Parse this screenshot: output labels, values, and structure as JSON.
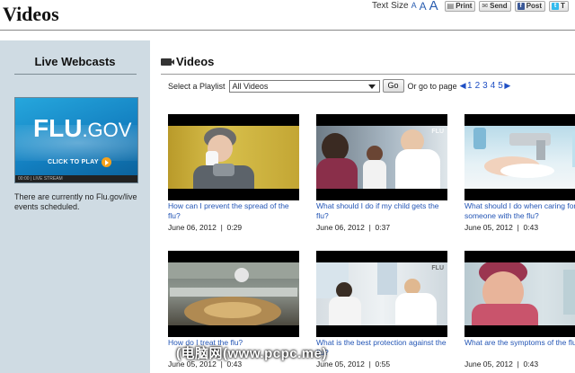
{
  "header": {
    "title": "Videos",
    "text_size_label": "Text Size",
    "text_size_glyphs": [
      "A",
      "A",
      "A"
    ],
    "buttons": [
      {
        "id": "print",
        "label": "Print",
        "icon": "printer-icon"
      },
      {
        "id": "send",
        "label": "Send",
        "icon": "envelope-icon"
      },
      {
        "id": "post",
        "label": "Post",
        "icon": "facebook-icon"
      },
      {
        "id": "tweet",
        "label": "T",
        "icon": "twitter-icon"
      }
    ]
  },
  "sidebar": {
    "title": "Live Webcasts",
    "thumbnail": {
      "logo_main": "FLU",
      "logo_suffix": ".GOV",
      "cta": "CLICK TO PLAY",
      "player_text": "00:00 | LIVE STREAM"
    },
    "note": "There are currently no Flu.gov/live events scheduled."
  },
  "main": {
    "title": "Videos",
    "playlist_label": "Select a Playlist",
    "playlist_selected": "All Videos",
    "go_label": "Go",
    "goto_label": "Or go to page",
    "pages": [
      "1",
      "2",
      "3",
      "4",
      "5"
    ],
    "prev_glyph": "◀",
    "next_glyph": "▶"
  },
  "videos": [
    {
      "title": "How can I prevent the spread of the flu?",
      "date": "June 06, 2012",
      "duration": "0:29"
    },
    {
      "title": "What should I do if my child gets the flu?",
      "date": "June 06, 2012",
      "duration": "0:37"
    },
    {
      "title": "What should I do when caring for someone with the flu?",
      "date": "June 05, 2012",
      "duration": "0:43"
    },
    {
      "title": "How do I treat the flu?",
      "date": "June 05, 2012",
      "duration": "0:43"
    },
    {
      "title": "What is the best protection against the flu?",
      "date": "June 05, 2012",
      "duration": "0:55"
    },
    {
      "title": "What are the symptoms of the flu?",
      "date": "June 05, 2012",
      "duration": "0:43"
    }
  ],
  "watermark": "(电脑网(www.pcpc.me)"
}
